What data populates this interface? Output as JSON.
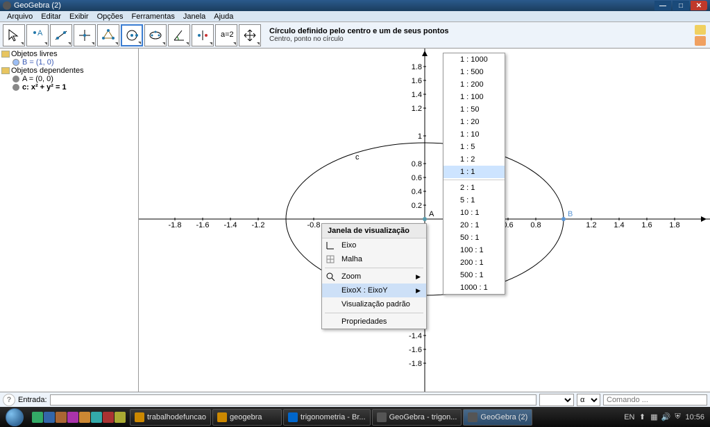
{
  "window": {
    "title": "GeoGebra (2)"
  },
  "menu": [
    "Arquivo",
    "Editar",
    "Exibir",
    "Opções",
    "Ferramentas",
    "Janela",
    "Ajuda"
  ],
  "tool": {
    "title": "Círculo definido pelo centro e um de seus pontos",
    "hint": "Centro, ponto no círculo"
  },
  "algebra": {
    "free_label": "Objetos livres",
    "dep_label": "Objetos dependentes",
    "B": "B = (1, 0)",
    "A": "A = (0, 0)",
    "c": "c: x² + y² = 1"
  },
  "chart_data": {
    "type": "other",
    "title": "Graphics view (ellipse rendered due to axis scale)",
    "xlabel": "",
    "ylabel": "",
    "xlim": [
      -2.0,
      2.0
    ],
    "ylim": [
      -2.0,
      2.0
    ],
    "xticks": [
      -1.8,
      -1.6,
      -1.4,
      -1.2,
      -0.8,
      0.8,
      1.2,
      1.4,
      1.6,
      1.8
    ],
    "xticks_right": [
      0.6,
      0.8
    ],
    "yticks_pos": [
      0.2,
      0.4,
      0.6,
      0.8,
      1,
      1.2,
      1.4,
      1.6,
      1.8
    ],
    "yticks_neg": [
      -1.4,
      -1.6,
      -1.8
    ],
    "curves": [
      {
        "name": "c",
        "equation": "x^2 + y^2 = 1",
        "render_rx": 1.0,
        "render_ry_visual": 0.5
      }
    ],
    "points": [
      {
        "name": "A",
        "x": 0,
        "y": 0
      },
      {
        "name": "B",
        "x": 1,
        "y": 0
      }
    ]
  },
  "context_menu": {
    "title": "Janela de visualização",
    "items": {
      "eixo": "Eixo",
      "malha": "Malha",
      "zoom": "Zoom",
      "ratio": "EixoX : EixoY",
      "padrao": "Visualização padrão",
      "props": "Propriedades"
    }
  },
  "ratio_menu": {
    "items": [
      "1 : 1000",
      "1 : 500",
      "1 : 200",
      "1 : 100",
      "1 : 50",
      "1 : 20",
      "1 : 10",
      "1 : 5",
      "1 : 2"
    ],
    "selected": "1 : 1",
    "items2": [
      "2 : 1",
      "5 : 1",
      "10 : 1",
      "20 : 1",
      "50 : 1",
      "100 : 1",
      "200 : 1",
      "500 : 1",
      "1000 : 1"
    ]
  },
  "inputbar": {
    "label": "Entrada:",
    "cmd_placeholder": "Comando ...",
    "alpha": "α"
  },
  "taskbar": {
    "tasks": [
      "trabalhodefuncao",
      "geogebra",
      "trigonometria - Br...",
      "GeoGebra - trigon...",
      "GeoGebra (2)"
    ],
    "lang": "EN",
    "clock": "10:56"
  }
}
